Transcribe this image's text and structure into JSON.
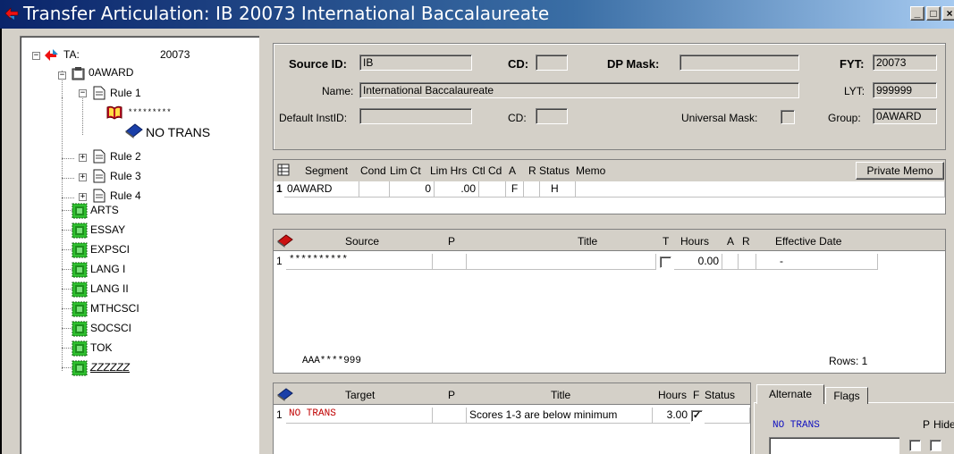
{
  "window": {
    "title": "Transfer Articulation: IB  20073 International Baccalaureate",
    "controls": [
      "_",
      "□",
      "×"
    ],
    "titlebar_color": "#0a246a"
  },
  "tree": {
    "root_label": "TA:",
    "root_value": "20073",
    "award": "0AWARD",
    "rule1": "Rule 1",
    "rule1_source": "*********",
    "rule1_target": "NO TRANS",
    "rule2": "Rule 2",
    "rule3": "Rule 3",
    "rule4": "Rule 4",
    "segments": [
      "ARTS",
      "ESSAY",
      "EXPSCI",
      "LANG I",
      "LANG II",
      "MTHCSCI",
      "SOCSCI",
      "TOK",
      "ZZZZZZ"
    ]
  },
  "header": {
    "source_id_label": "Source ID:",
    "source_id": "IB",
    "cd_label": "CD:",
    "cd_value": "",
    "dp_mask_label": "DP Mask:",
    "dp_mask": "",
    "fyt_label": "FYT:",
    "fyt": "20073",
    "name_label": "Name:",
    "name": "International Baccalaureate",
    "lyt_label": "LYT:",
    "lyt": "999999",
    "default_instid_label": "Default InstID:",
    "default_instid": "",
    "cd2_label": "CD:",
    "cd2_value": "",
    "universal_mask_label": "Universal Mask:",
    "group_label": "Group:",
    "group": "0AWARD"
  },
  "segment_grid": {
    "headers": [
      "Segment",
      "Cond",
      "Lim Ct",
      "Lim Hrs",
      "Ctl Cd",
      "A",
      "R",
      "Status",
      "Memo"
    ],
    "private_memo_label": "Private Memo",
    "row": {
      "num": "1",
      "segment": "0AWARD",
      "cond": "",
      "lim_ct": "0",
      "lim_hrs": ".00",
      "ctl_cd": "",
      "a": "F",
      "r": "",
      "status": "H",
      "memo": ""
    }
  },
  "source_grid": {
    "headers": [
      "Source",
      "P",
      "Title",
      "T",
      "Hours",
      "A",
      "R",
      "Effective Date"
    ],
    "row": {
      "num": "1",
      "source": "**********",
      "p": "",
      "title": "",
      "t": "",
      "hours": "0.00",
      "a": "",
      "r": "",
      "effective_date": "-"
    },
    "footer_mask": "AAA****999",
    "rows_label": "Rows: 1"
  },
  "target_grid": {
    "headers": [
      "Target",
      "P",
      "Title",
      "Hours",
      "F",
      "Status"
    ],
    "row": {
      "num": "1",
      "target": "NO TRANS",
      "p": "",
      "title": "Scores 1-3 are below minimum",
      "hours": "3.00",
      "f": "✓",
      "status": ""
    }
  },
  "side_tabs": {
    "tabs": [
      "Alternate",
      "Flags"
    ],
    "active": "Alternate",
    "alt_value": "NO TRANS",
    "p_label": "P",
    "hide_label": "Hide"
  }
}
